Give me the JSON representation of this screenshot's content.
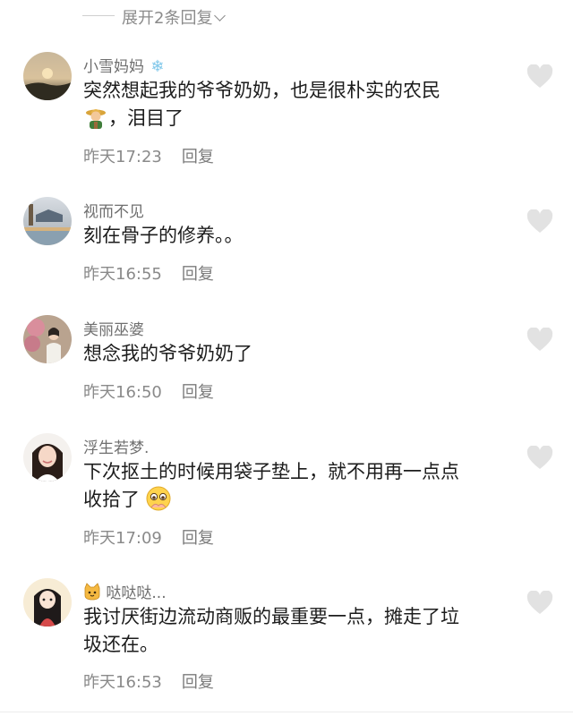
{
  "expand": {
    "label": "展开2条回复"
  },
  "comments": [
    {
      "name": "小雪妈妈",
      "text": "突然想起我的爷爷奶奶，也是很朴实的农民",
      "text2": "，泪目了",
      "time": "昨天17:23",
      "reply": "回复"
    },
    {
      "name": "视而不见",
      "text": "刻在骨子的修养。。",
      "time": "昨天16:55",
      "reply": "回复"
    },
    {
      "name": "美丽巫婆",
      "text": "想念我的爷爷奶奶了",
      "time": "昨天16:50",
      "reply": "回复"
    },
    {
      "name": "浮生若梦.",
      "text": "下次抠土的时候用袋子垫上，就不用再一点点",
      "text2": "收拾了",
      "time": "昨天17:09",
      "reply": "回复"
    },
    {
      "name": "哒哒哒...",
      "text": "我讨厌街边流动商贩的最重要一点，摊走了垃",
      "text2": "圾还在。",
      "time": "昨天16:53",
      "reply": "回复"
    }
  ]
}
